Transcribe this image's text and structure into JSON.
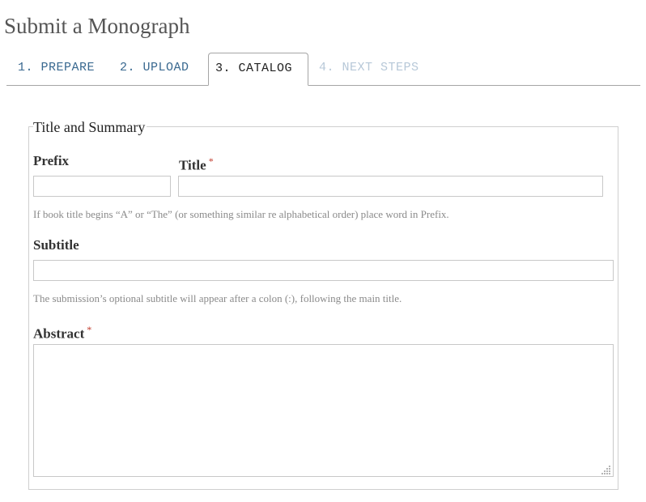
{
  "page": {
    "title": "Submit a Monograph"
  },
  "tabs": [
    {
      "label": "1. PREPARE",
      "state": "visited"
    },
    {
      "label": "2. UPLOAD",
      "state": "visited"
    },
    {
      "label": "3. CATALOG",
      "state": "active"
    },
    {
      "label": "4. NEXT STEPS",
      "state": "disabled"
    }
  ],
  "section": {
    "legend": "Title and Summary"
  },
  "fields": {
    "prefix": {
      "label": "Prefix",
      "value": ""
    },
    "title": {
      "label": "Title",
      "required_mark": "*",
      "value": ""
    },
    "prefix_help": "If book title begins “A” or “The” (or something similar re alphabetical order) place word in Prefix.",
    "subtitle": {
      "label": "Subtitle",
      "value": "",
      "help": "The submission’s optional subtitle will appear after a colon (:), following the main title."
    },
    "abstract": {
      "label": "Abstract",
      "required_mark": "*",
      "value": ""
    }
  },
  "colors": {
    "tab_link": "#3a6990",
    "tab_disabled": "#b7c8d8",
    "required": "#c0392b",
    "help_text": "#8a8a8a"
  },
  "icons": {
    "resize_grip": "resize-grip-icon"
  }
}
